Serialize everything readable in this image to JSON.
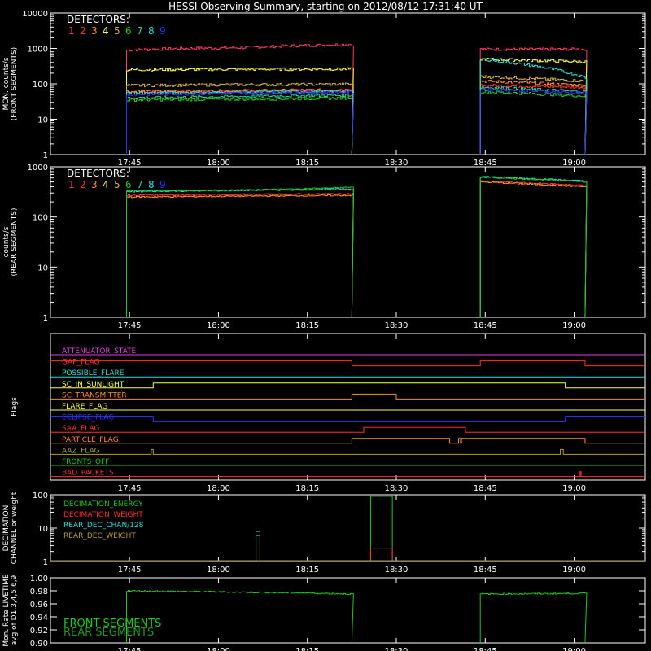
{
  "title": "HESSI Observing Summary, starting on 2012/08/12 17:31:40 UT",
  "time_ticks": [
    "17:45",
    "18:00",
    "18:15",
    "18:30",
    "18:45",
    "19:00"
  ],
  "colors": {
    "axis": "#ffffff",
    "d1": "#ff3c64",
    "d2": "#ff3030",
    "d3": "#ff8c28",
    "d4": "#ffff3c",
    "d5": "#d2b43c",
    "d6": "#1ec81e",
    "d7": "#28d28c",
    "d8": "#28dcdc",
    "d9": "#3232ff"
  },
  "chart_data": [
    {
      "id": "front",
      "type": "line",
      "ylabel": [
        "MON. counts/s",
        "(FRONT SEGMENTS)"
      ],
      "scale": "log",
      "ylim": [
        1,
        10000
      ],
      "yticks": [
        "1",
        "10",
        "100",
        "1000",
        "10000"
      ],
      "xlim": [
        "17:31:40",
        "19:12:00"
      ],
      "legend_title": "DETECTORS:",
      "legend": [
        "1",
        "2",
        "3",
        "4",
        "5",
        "6",
        "7",
        "8",
        "9"
      ],
      "series": [
        {
          "name": "1",
          "color": "d1",
          "values": [
            900,
            1000,
            1050,
            1200,
            1300
          ],
          "values2": [
            950,
            950
          ]
        },
        {
          "name": "2",
          "color": "d2",
          "values": [
            60,
            60,
            62,
            65,
            65
          ],
          "values2": [
            90,
            80
          ]
        },
        {
          "name": "3",
          "color": "d3",
          "values": [
            60,
            62,
            64,
            66,
            68
          ],
          "values2": [
            120,
            90
          ]
        },
        {
          "name": "4",
          "color": "d4",
          "values": [
            250,
            255,
            258,
            260,
            262
          ],
          "values2": [
            500,
            420
          ]
        },
        {
          "name": "5",
          "color": "d5",
          "values": [
            90,
            92,
            95,
            96,
            98
          ],
          "values2": [
            160,
            120
          ]
        },
        {
          "name": "6",
          "color": "d6",
          "values": [
            35,
            36,
            37,
            38,
            40
          ],
          "values2": [
            60,
            45
          ]
        },
        {
          "name": "7",
          "color": "d7",
          "values": [
            40,
            42,
            44,
            46,
            48
          ],
          "values2": [
            80,
            60
          ]
        },
        {
          "name": "8",
          "color": "d8",
          "values": [
            55,
            56,
            58,
            60,
            62
          ],
          "values2": [
            500,
            150
          ]
        },
        {
          "name": "9",
          "color": "d9",
          "values": [
            50,
            52,
            54,
            56,
            58
          ],
          "values2": [
            70,
            55
          ]
        }
      ],
      "intervals": [
        [
          "17:44:30",
          "18:22:30"
        ],
        [
          "18:44:10",
          "19:01:50"
        ]
      ]
    },
    {
      "id": "rear",
      "type": "line",
      "ylabel": [
        "counts/s",
        "(REAR SEGMENTS)"
      ],
      "scale": "log",
      "ylim": [
        1,
        1000
      ],
      "yticks": [
        "1",
        "10",
        "100",
        "1000"
      ],
      "xlim": [
        "17:31:40",
        "19:12:00"
      ],
      "legend_title": "DETECTORS:",
      "legend": [
        "1",
        "2",
        "3",
        "4",
        "5",
        "6",
        "7",
        "8",
        "9"
      ],
      "series": [
        {
          "name": "2",
          "color": "d2",
          "values": [
            270,
            275,
            280,
            285,
            290
          ],
          "values2": [
            520,
            420
          ]
        },
        {
          "name": "3",
          "color": "d3",
          "values": [
            250,
            255,
            260,
            265,
            270
          ],
          "values2": [
            500,
            400
          ]
        },
        {
          "name": "8",
          "color": "d8",
          "values": [
            320,
            330,
            340,
            350,
            360
          ],
          "values2": [
            640,
            520
          ]
        },
        {
          "name": "6",
          "color": "d6",
          "values": [
            330,
            335,
            345,
            360,
            390
          ],
          "values2": [
            620,
            500
          ]
        }
      ],
      "intervals": [
        [
          "17:44:30",
          "18:22:30"
        ],
        [
          "18:44:10",
          "19:01:50"
        ]
      ]
    },
    {
      "id": "flags",
      "type": "line",
      "ylabel": [
        "Flags"
      ],
      "xlim": [
        "17:31:40",
        "19:12:00"
      ],
      "rows": [
        {
          "label": "ATTENUATOR_STATE",
          "color": "#e040e0"
        },
        {
          "label": "GAP_FLAG",
          "color": "#ff3030"
        },
        {
          "label": "POSSIBLE_FLARE",
          "color": "#28dcdc"
        },
        {
          "label": "SC_IN_SUNLIGHT",
          "color": "#ffff3c"
        },
        {
          "label": "SC_TRANSMITTER",
          "color": "#ff8c28"
        },
        {
          "label": "FLARE_FLAG",
          "color": "#ffff3c"
        },
        {
          "label": "ECLIPSE_FLAG",
          "color": "#3232ff"
        },
        {
          "label": "SAA_FLAG",
          "color": "#ff3030"
        },
        {
          "label": "PARTICLE_FLAG",
          "color": "#ff8c28"
        },
        {
          "label": "AAZ_FLAG",
          "color": "#b4a028"
        },
        {
          "label": "FRONTS_OFF",
          "color": "#1ec81e"
        },
        {
          "label": "BAD_PACKETS",
          "color": "#ff3030"
        }
      ]
    },
    {
      "id": "decimation",
      "type": "line",
      "ylabel": [
        "DECIMATION",
        "CHANNEL or weight"
      ],
      "scale": "log",
      "ylim": [
        1,
        100
      ],
      "yticks": [
        "1",
        "10",
        "100"
      ],
      "xlim": [
        "17:31:40",
        "19:12:00"
      ],
      "legend": [
        {
          "label": "DECIMATION_ENERGY",
          "color": "#1ec81e"
        },
        {
          "label": "DECIMATION_WEIGHT",
          "color": "#ff3030"
        },
        {
          "label": "REAR_DEC_CHAN/128",
          "color": "#28dcdc"
        },
        {
          "label": "REAR_DEC_WEIGHT",
          "color": "#b4a028"
        }
      ]
    },
    {
      "id": "livetime",
      "type": "line",
      "ylabel": [
        "Mon. Rate LIVETIME",
        "avg of D1,3,4,5,6,9"
      ],
      "ylim": [
        0.9,
        1.0
      ],
      "yticks": [
        "0.90",
        "0.92",
        "0.94",
        "0.96",
        "0.98",
        "1.00"
      ],
      "xlim": [
        "17:31:40",
        "19:12:00"
      ],
      "legend": [
        {
          "label": "FRONT SEGMENTS",
          "color": "#1ec81e"
        },
        {
          "label": "REAR SEGMENTS",
          "color": "#1e961e"
        }
      ],
      "series": [
        {
          "name": "FRONT SEGMENTS",
          "values": [
            0.98,
            0.979,
            0.978,
            0.977,
            0.975
          ],
          "values2": [
            0.975,
            0.976
          ]
        }
      ]
    }
  ]
}
